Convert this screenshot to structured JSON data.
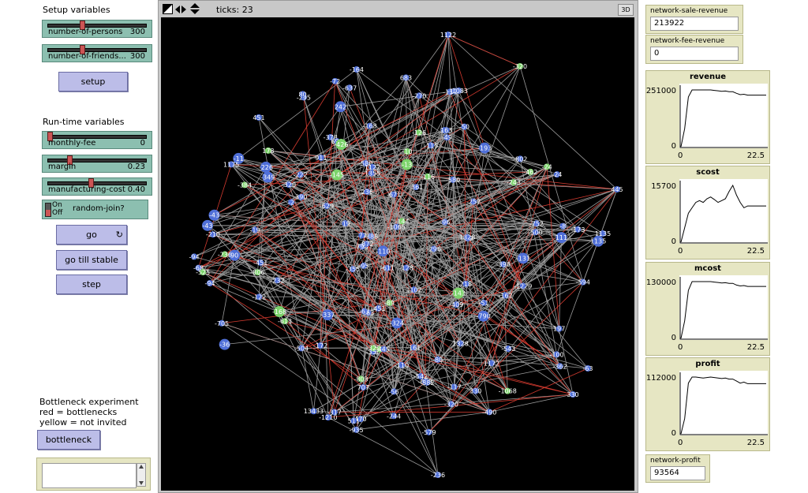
{
  "setup_section": {
    "label": "Setup variables"
  },
  "sliders_setup": [
    {
      "label": "number-of-persons",
      "value": "300",
      "fraction": 0.33
    },
    {
      "label": "number-of-friends...",
      "value": "300",
      "fraction": 0.33
    }
  ],
  "setup_button": {
    "label": "setup"
  },
  "runtime_section": {
    "label": "Run-time variables"
  },
  "sliders_runtime": [
    {
      "label": "monthly-fee",
      "value": "0",
      "fraction": 0.0
    },
    {
      "label": "margin",
      "value": "0.23",
      "fraction": 0.2
    },
    {
      "label": "manufacturing-cost",
      "value": "0.40",
      "fraction": 0.42
    }
  ],
  "switch": {
    "on_label": "On",
    "off_label": "Off",
    "label": "random-join?"
  },
  "buttons": {
    "go": "go",
    "go_till_stable": "go till stable",
    "step": "step",
    "bottleneck": "bottleneck"
  },
  "go_icon": "forever-icon",
  "bottleneck_text": {
    "line1": "Bottleneck experiment",
    "line2": "red = bottlenecks",
    "line3": "yellow = not invited"
  },
  "world": {
    "ticks_label": "ticks: 23",
    "three_d_label": "3D"
  },
  "monitors": {
    "network_sale_revenue": {
      "label": "network-sale-revenue",
      "value": "213922"
    },
    "network_fee_revenue": {
      "label": "network-fee-revenue",
      "value": "0"
    },
    "network_profit": {
      "label": "network-profit",
      "value": "93564"
    }
  },
  "chart_data": [
    {
      "type": "line",
      "title": "revenue",
      "ymax_label": "251000",
      "ymin_label": "0",
      "xmin_label": "0",
      "xmax_label": "22.5",
      "x": [
        0,
        1,
        2,
        3,
        4,
        5,
        6,
        7,
        8,
        9,
        10,
        11,
        12,
        13,
        14,
        15,
        16,
        17,
        18,
        19,
        20,
        21,
        22,
        23
      ],
      "values": [
        0,
        80000,
        220000,
        251000,
        251000,
        251000,
        251000,
        251000,
        251000,
        249000,
        247000,
        245000,
        246000,
        243000,
        243000,
        236000,
        230000,
        232000,
        228000,
        228000,
        228000,
        228000,
        228000,
        228000
      ]
    },
    {
      "type": "line",
      "title": "scost",
      "ymax_label": "15700",
      "ymin_label": "0",
      "xmin_label": "0",
      "xmax_label": "22.5",
      "x": [
        0,
        1,
        2,
        3,
        4,
        5,
        6,
        7,
        8,
        9,
        10,
        11,
        12,
        13,
        14,
        15,
        16,
        17,
        18,
        19,
        20,
        21,
        22,
        23
      ],
      "values": [
        0,
        4000,
        8000,
        9500,
        11000,
        11500,
        11000,
        12000,
        12500,
        11800,
        11000,
        11500,
        12000,
        14000,
        15700,
        13000,
        11000,
        9500,
        10000,
        10000,
        10000,
        10000,
        10000,
        10000
      ]
    },
    {
      "type": "line",
      "title": "mcost",
      "ymax_label": "130000",
      "ymin_label": "0",
      "xmin_label": "0",
      "xmax_label": "22.5",
      "x": [
        0,
        1,
        2,
        3,
        4,
        5,
        6,
        7,
        8,
        9,
        10,
        11,
        12,
        13,
        14,
        15,
        16,
        17,
        18,
        19,
        20,
        21,
        22,
        23
      ],
      "values": [
        0,
        40000,
        110000,
        130000,
        130000,
        130000,
        130000,
        130000,
        130000,
        129000,
        128000,
        127000,
        127500,
        126000,
        126000,
        122000,
        120000,
        121000,
        119000,
        119000,
        119000,
        119000,
        119000,
        119000
      ]
    },
    {
      "type": "line",
      "title": "profit",
      "ymax_label": "112000",
      "ymin_label": "0",
      "xmin_label": "0",
      "xmax_label": "22.5",
      "x": [
        0,
        1,
        2,
        3,
        4,
        5,
        6,
        7,
        8,
        9,
        10,
        11,
        12,
        13,
        14,
        15,
        16,
        17,
        18,
        19,
        20,
        21,
        22,
        23
      ],
      "values": [
        0,
        30000,
        100000,
        112000,
        112000,
        111000,
        110000,
        111000,
        112000,
        111000,
        110000,
        109000,
        110000,
        108000,
        108000,
        104000,
        100000,
        102000,
        99000,
        99000,
        99000,
        99000,
        99000,
        99000
      ]
    }
  ],
  "network_labels": [
    "1122",
    "-320",
    "445",
    "-63",
    "-236",
    "-94",
    "330",
    "1135",
    "1328",
    "-500",
    "-705",
    "-43",
    "-19",
    "-580",
    "-36",
    "-324",
    "-358",
    "-8",
    "178",
    "-122",
    "-68",
    "-462",
    "911",
    "470",
    "-117",
    "-384",
    "-51",
    "-1210",
    "-613",
    "-637",
    "-11",
    "-56",
    "-378",
    "236",
    "698",
    "-172",
    "-543",
    "-210",
    "-806",
    "-611",
    "-143",
    "-270",
    "-659",
    "-100",
    "-161",
    "-244",
    "707",
    "242",
    "-144",
    "-232",
    "-2",
    "390",
    "-222",
    "-1229",
    "-296",
    "-490",
    "-164",
    "-295",
    "-226",
    "-24",
    "511",
    "-43",
    "-579",
    "13433",
    "-1355",
    "-13",
    "-110",
    "-162",
    "1102",
    "90",
    "-49",
    "363",
    "-126",
    "-135",
    "80",
    "-8",
    "-19",
    "-322",
    "-193",
    "-362",
    "-173",
    "111",
    "-115",
    "-243",
    "-409",
    "-355",
    "451",
    "-337",
    "-594",
    "-145",
    "-349",
    "-340",
    "-790",
    "-525",
    "-426",
    "-320",
    "-382",
    "-398",
    "-168",
    "-96",
    "-116",
    "-24",
    "-451",
    "-451",
    "798",
    "683",
    "1172",
    "163",
    "-752",
    "-50",
    "-59",
    "-803",
    "-89",
    "-128",
    "-257",
    "-542",
    "-168",
    "-72",
    "-671",
    "-95",
    "-116",
    "-77",
    "-131",
    "-504",
    "-110",
    "-388",
    "218",
    "1175",
    "197",
    "-317",
    "-629",
    "-872",
    "-580",
    "-1083",
    "-1068",
    "-361",
    "-802",
    "-935",
    "-1065",
    "-10",
    "-80"
  ],
  "palette": {
    "node_blue": "#4f6fd8",
    "node_green": "#7cd36b",
    "edge_gray": "#9a9a9a",
    "edge_red": "#d23a2f",
    "label_white": "#ffffff"
  }
}
